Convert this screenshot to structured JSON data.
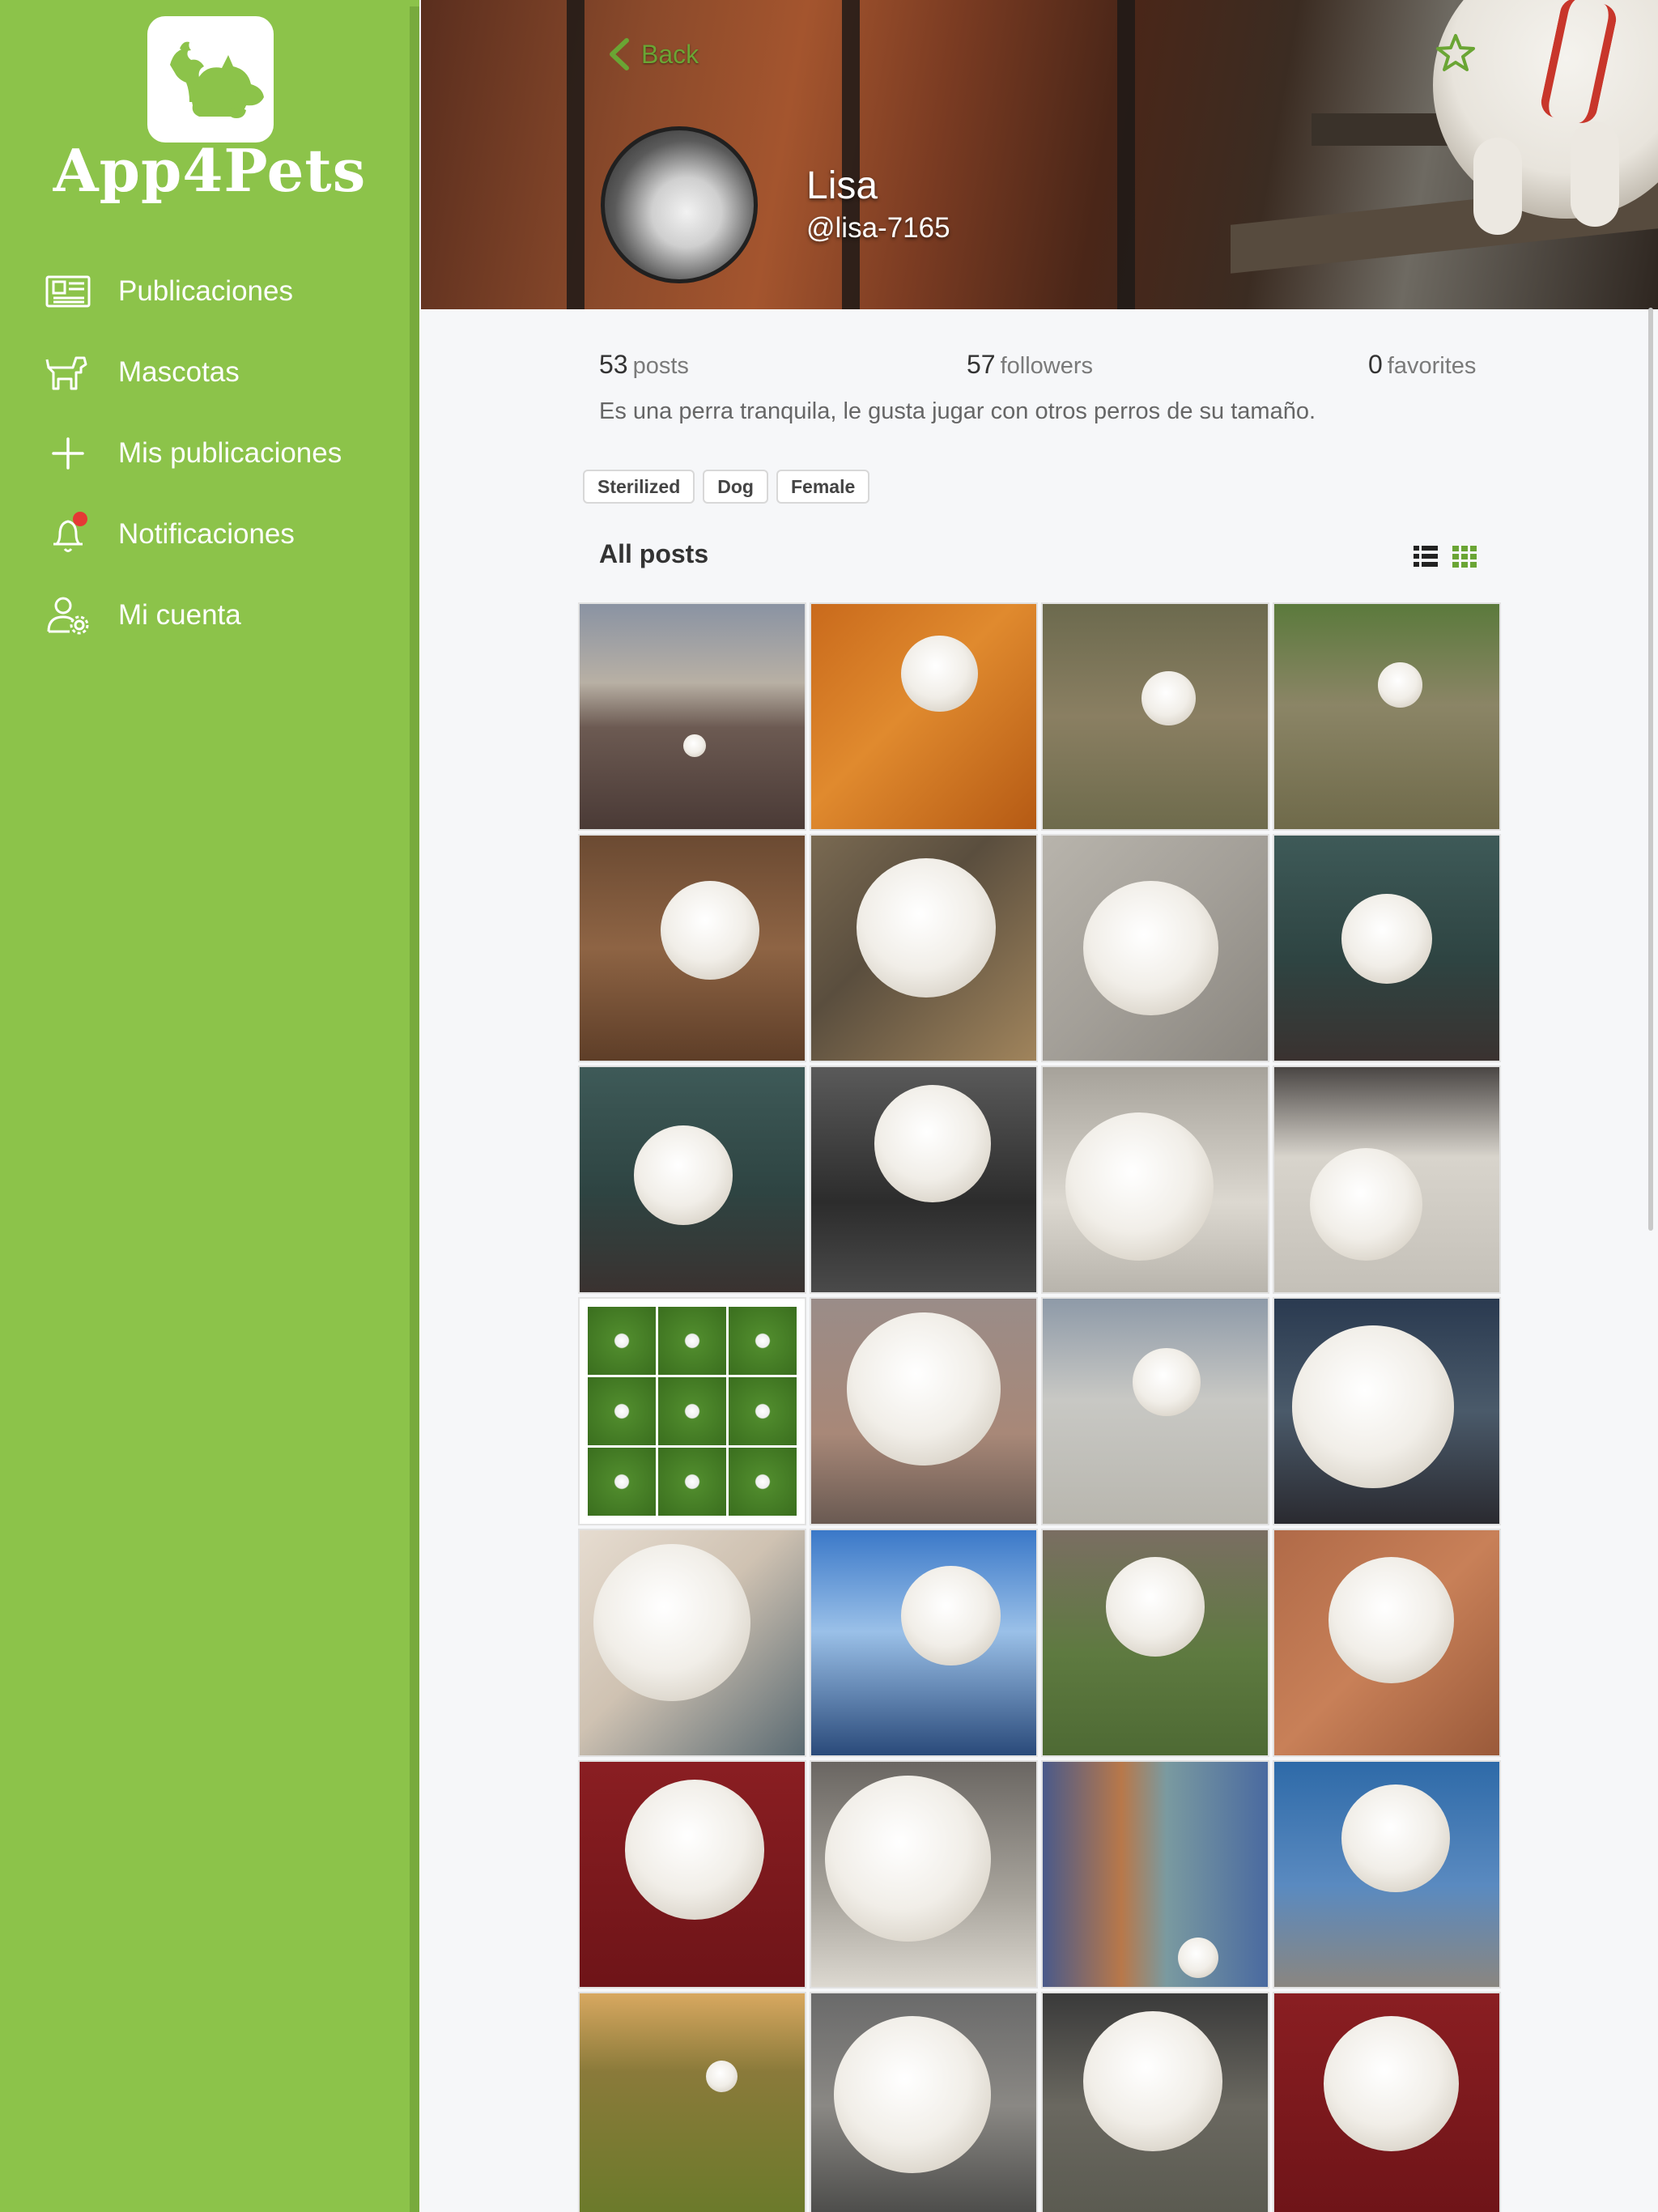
{
  "app": {
    "name": "App4Pets",
    "brand_color": "#8cc34a",
    "accent_color": "#6aa534"
  },
  "sidebar": {
    "items": [
      {
        "label": "Publicaciones",
        "icon": "newspaper-icon"
      },
      {
        "label": "Mascotas",
        "icon": "dog-icon"
      },
      {
        "label": "Mis publicaciones",
        "icon": "plus-icon"
      },
      {
        "label": "Notificaciones",
        "icon": "bell-icon",
        "has_notification": true
      },
      {
        "label": "Mi cuenta",
        "icon": "user-settings-icon"
      }
    ]
  },
  "header": {
    "back_label": "Back",
    "favorite_icon": "star-icon"
  },
  "profile": {
    "name": "Lisa",
    "handle": "@lisa-7165",
    "stats": {
      "posts": {
        "value": "53",
        "label": "posts"
      },
      "followers": {
        "value": "57",
        "label": "followers"
      },
      "favorites": {
        "value": "0",
        "label": "favorites"
      }
    },
    "bio": "Es una perra tranquila, le gusta jugar con otros perros de su tamaño.",
    "tags": [
      "Sterilized",
      "Dog",
      "Female"
    ]
  },
  "posts": {
    "title": "All posts",
    "view_modes": [
      "list-view-icon",
      "grid-view-icon"
    ],
    "active_view": "grid",
    "tiles": [
      {
        "bg": "linear-gradient(180deg,#8a93a3 0%,#b8b0a4 35%,#6c5a52 55%,#4a3a36 100%)",
        "dog": [
          46,
          58,
          10
        ]
      },
      {
        "bg": "linear-gradient(135deg,#c96a1c 0%,#e08a2e 45%,#b55a14 100%)",
        "dog": [
          40,
          14,
          34
        ]
      },
      {
        "bg": "linear-gradient(180deg,#6c6a4e 0%,#8a7f62 50%,#6e6b4c 100%)",
        "dog": [
          44,
          30,
          24
        ]
      },
      {
        "bg": "linear-gradient(180deg,#5b7a3c 0%,#8b8566 45%,#6f6a4a 100%)",
        "dog": [
          46,
          26,
          20
        ]
      },
      {
        "bg": "linear-gradient(180deg,#6b4a32 0%,#8e6444 50%,#5e3e28 100%)",
        "dog": [
          36,
          20,
          44
        ]
      },
      {
        "bg": "linear-gradient(135deg,#7a6a52 0%,#5a4e3e 40%,#a0845c 100%)",
        "dog": [
          20,
          10,
          62
        ]
      },
      {
        "bg": "linear-gradient(135deg,#b8b4ac 0%,#a39f98 50%,#8a867f 100%)",
        "dog": [
          18,
          20,
          60
        ]
      },
      {
        "bg": "linear-gradient(180deg,#3e5a58 0%,#2e4442 55%,#3a3230 100%)",
        "dog": [
          30,
          26,
          40
        ]
      },
      {
        "bg": "linear-gradient(180deg,#3e5a58 0%,#2e4442 55%,#3a3230 100%)",
        "dog": [
          24,
          26,
          44
        ]
      },
      {
        "bg": "linear-gradient(180deg,#5a5a5a 0%,#2c2c2c 60%,#4a4a4a 100%)",
        "dog": [
          28,
          8,
          52
        ]
      },
      {
        "bg": "linear-gradient(180deg,#a6a29a 0%,#dcd8d0 60%,#b8b4ac 100%)",
        "dog": [
          10,
          20,
          66
        ]
      },
      {
        "bg": "linear-gradient(180deg,#4a4644 0%,#d8d4cc 40%,#c4c0b8 100%)",
        "dog": [
          16,
          36,
          50
        ]
      },
      {
        "mosaic": true
      },
      {
        "bg": "linear-gradient(180deg,#9a8c88 0%,#a88878 60%,#6a5a52 100%)",
        "dog": [
          16,
          6,
          68
        ]
      },
      {
        "bg": "linear-gradient(180deg,#8e9aa8 0%,#c8c8c4 45%,#b8b6ae 100%)",
        "dog": [
          40,
          22,
          30
        ]
      },
      {
        "bg": "linear-gradient(180deg,#2a3a50 0%,#4a5a6a 50%,#2a2a30 100%)",
        "dog": [
          8,
          12,
          72
        ]
      },
      {
        "bg": "linear-gradient(135deg,#e6dcd0 0%,#cfc2b2 45%,#5a6a72 100%)",
        "dog": [
          6,
          6,
          70
        ]
      },
      {
        "bg": "linear-gradient(180deg,#3a78c8 0%,#9ac0e8 45%,#2a4a7a 100%)",
        "dog": [
          40,
          16,
          44
        ]
      },
      {
        "bg": "linear-gradient(180deg,#7a6e62 0%,#5e7a40 55%,#4e6a34 100%)",
        "dog": [
          28,
          12,
          44
        ]
      },
      {
        "bg": "linear-gradient(135deg,#b06a48 0%,#c88058 50%,#9a5a3a 100%)",
        "dog": [
          24,
          12,
          56
        ]
      },
      {
        "bg": "linear-gradient(180deg,#8a1e22 0%,#6e1418 100%)",
        "dog": [
          20,
          8,
          62
        ]
      },
      {
        "bg": "linear-gradient(180deg,#6a6662 0%,#a8a49c 60%,#dcd8d0 100%)",
        "dog": [
          6,
          6,
          74
        ]
      },
      {
        "bg": "linear-gradient(90deg,#4a5a8a 0%,#b8784a 35%,#7a9aa0 55%,#4a6aa0 100%)",
        "dog": [
          60,
          78,
          18
        ]
      },
      {
        "bg": "linear-gradient(180deg,#2e6aa8 0%,#5a8ac0 55%,#8a8680 100%)",
        "dog": [
          30,
          10,
          48
        ]
      },
      {
        "bg": "linear-gradient(180deg,#d8a860 0%,#8a7a3a 35%,#6a7a2a 100%)",
        "dog": [
          56,
          30,
          14
        ]
      },
      {
        "bg": "linear-gradient(180deg,#6a6a6a 0%,#8a8884 50%,#4a4a48 100%)",
        "dog": [
          10,
          10,
          70
        ]
      },
      {
        "bg": "linear-gradient(180deg,#3a3a3a 0%,#6a6860 50%,#5a5a50 100%)",
        "dog": [
          18,
          8,
          62
        ]
      },
      {
        "bg": "linear-gradient(180deg,#8a1e22 0%,#6e1418 100%)",
        "dog": [
          22,
          10,
          60
        ]
      }
    ]
  }
}
